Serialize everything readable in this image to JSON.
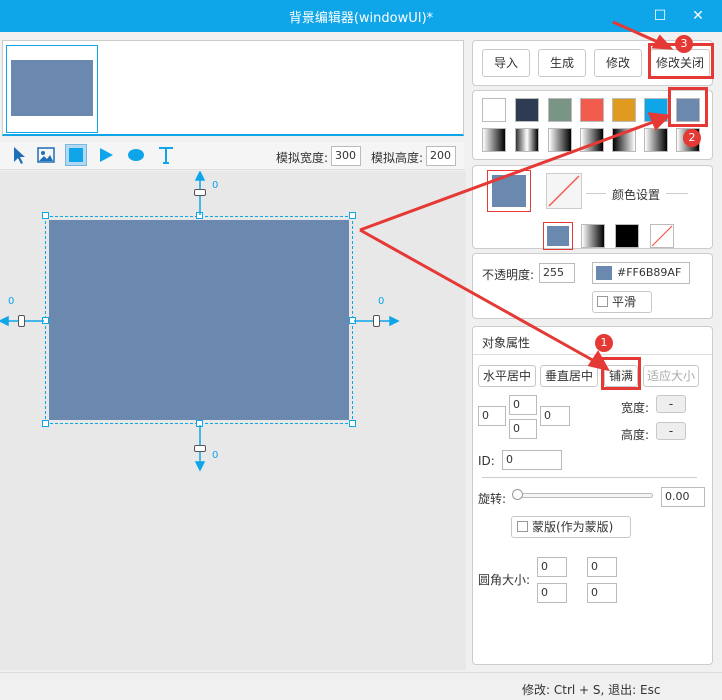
{
  "window": {
    "title": "背景编辑器(windowUI)*"
  },
  "toolbar": {
    "sim_width_label": "模拟宽度:",
    "sim_width": "300",
    "sim_height_label": "模拟高度:",
    "sim_height": "200"
  },
  "canvas": {
    "fill_color": "#6B89AF",
    "offset_top": "0",
    "offset_bottom": "0",
    "offset_left": "0",
    "offset_right": "0"
  },
  "actions": {
    "import": "导入",
    "generate": "生成",
    "modify": "修改",
    "modify_close": "修改关闭"
  },
  "color_settings": {
    "label": "颜色设置"
  },
  "opacity": {
    "label": "不透明度:",
    "value": "255",
    "hex": "#FF6B89AF",
    "smooth": "平滑"
  },
  "object_props": {
    "title": "对象属性",
    "h_center": "水平居中",
    "v_center": "垂直居中",
    "fill": "铺满",
    "fit_size": "适应大小",
    "margin_left": "0",
    "margin_top": "0",
    "margin_bottom": "0",
    "margin_right": "0",
    "width_label": "宽度:",
    "width_value": "-",
    "height_label": "高度:",
    "height_value": "-",
    "id_label": "ID:",
    "id_value": "0",
    "rotate_label": "旋转:",
    "rotate_value": "0.00",
    "mask_label": "蒙版(作为蒙版)",
    "radius_label": "圆角大小:",
    "r_tl": "0",
    "r_tr": "0",
    "r_bl": "0",
    "r_br": "0"
  },
  "status": {
    "text": "修改: Ctrl + S, 退出: Esc"
  },
  "annotations": {
    "n1": "1",
    "n2": "2",
    "n3": "3"
  },
  "colors": {
    "accent": "#0ea5e9",
    "fill": "#6B89AF",
    "highlight": "#e53935"
  }
}
